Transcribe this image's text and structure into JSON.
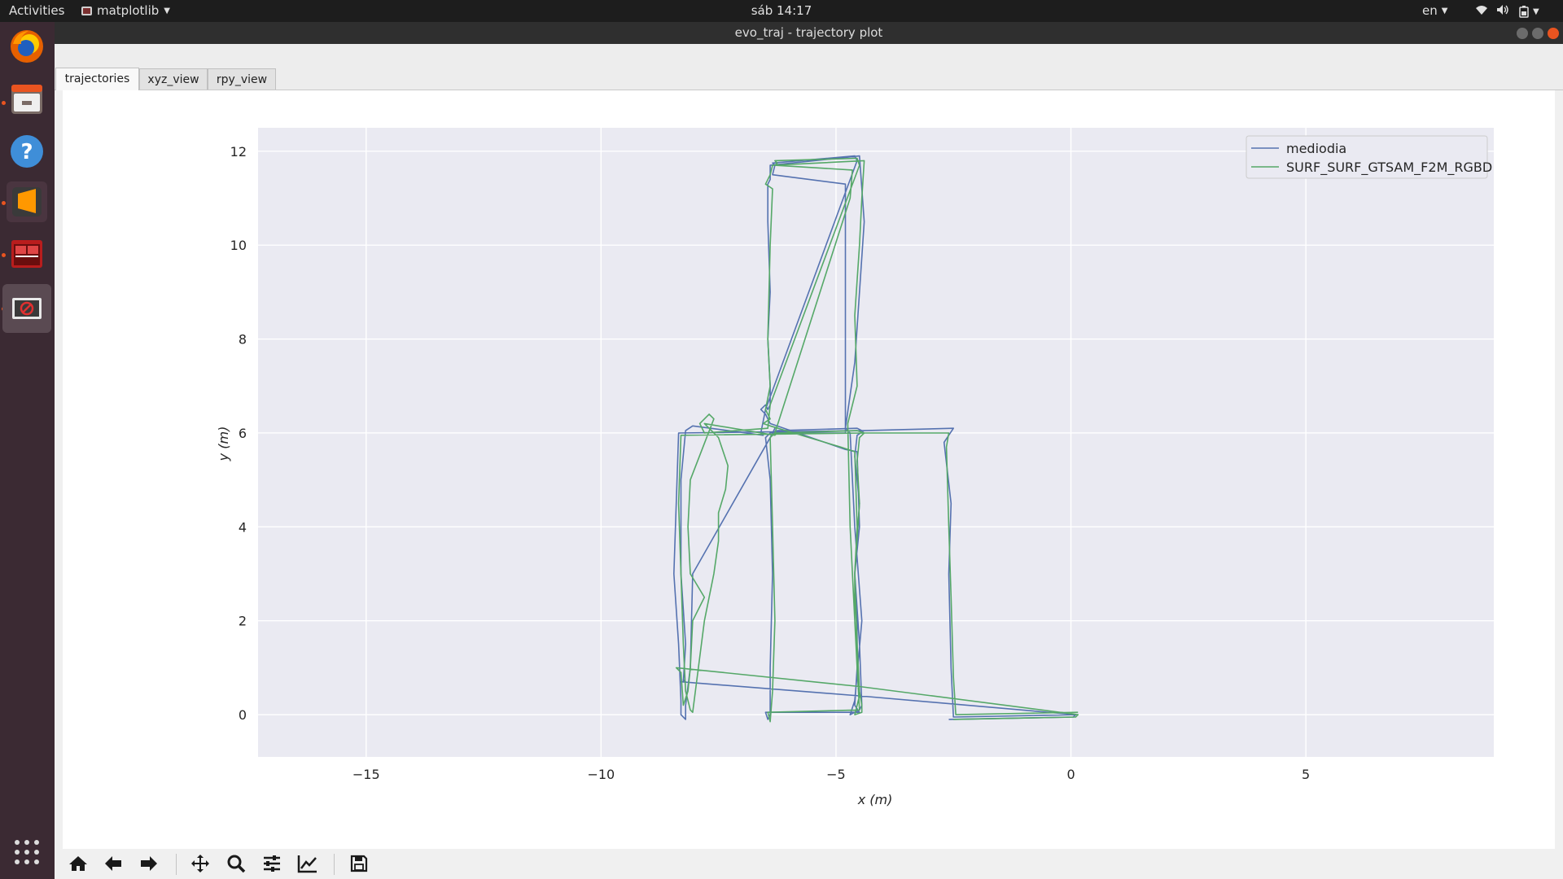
{
  "topbar": {
    "activities": "Activities",
    "app_menu": "matplotlib",
    "clock": "sáb 14:17",
    "language": "en"
  },
  "window": {
    "title": "evo_traj - trajectory plot"
  },
  "tabs": [
    {
      "label": "trajectories",
      "active": true
    },
    {
      "label": "xyz_view",
      "active": false
    },
    {
      "label": "rpy_view",
      "active": false
    }
  ],
  "dock": {
    "items": [
      {
        "name": "firefox-icon",
        "running": true
      },
      {
        "name": "files-icon",
        "running": true
      },
      {
        "name": "help-icon",
        "running": false
      },
      {
        "name": "sublime-text-icon",
        "running": true
      },
      {
        "name": "terminal-icon",
        "running": true
      },
      {
        "name": "matplotlib-window-icon",
        "running": true
      }
    ]
  },
  "toolbar": {
    "tools": [
      "home-icon",
      "back-arrow-icon",
      "forward-arrow-icon",
      "pan-icon",
      "zoom-icon",
      "configure-subplots-icon",
      "edit-axis-icon",
      "save-icon"
    ]
  },
  "colors": {
    "mediodia": "#5572b0",
    "surf": "#55a868",
    "axes_bg": "#eaeaf2",
    "grid": "#ffffff"
  },
  "chart_data": {
    "type": "line",
    "xlabel": "x (m)",
    "ylabel": "y (m)",
    "xlim": [
      -17.3,
      9.0
    ],
    "ylim": [
      -0.9,
      12.5
    ],
    "xticks": [
      -15,
      -10,
      -5,
      0,
      5
    ],
    "yticks": [
      0,
      2,
      4,
      6,
      8,
      10,
      12
    ],
    "xtick_labels": [
      "−15",
      "−10",
      "−5",
      "0",
      "5"
    ],
    "ytick_labels": [
      "0",
      "2",
      "4",
      "6",
      "8",
      "10",
      "12"
    ],
    "grid": true,
    "legend_position": "top-right",
    "series": [
      {
        "name": "mediodia",
        "x": [
          0.1,
          -2.5,
          -2.55,
          -2.6,
          -2.55,
          -2.7,
          -2.5,
          -4.4,
          -4.55,
          -4.6,
          -4.5,
          -4.6,
          -4.5,
          -4.45,
          -4.5,
          -4.6,
          -4.7,
          -4.6,
          -4.45,
          -4.6,
          -4.7,
          -4.8,
          -4.6,
          -4.5,
          -4.4,
          -4.5,
          -6.4,
          -6.4,
          -6.45,
          -6.45,
          -6.4,
          -6.45,
          -6.4,
          -6.4,
          -6.45,
          -6.5,
          -6.6,
          -6.5,
          -6.45,
          -6.4,
          -4.8,
          -4.55,
          -4.5,
          -4.6,
          -4.55,
          -4.55,
          -4.6,
          -4.5,
          -6.5,
          -6.45,
          -6.4,
          -6.4,
          -6.35,
          -6.4,
          -6.5,
          -6.4,
          -6.25,
          -4.55,
          -4.45,
          -4.35,
          -8.35,
          -8.4,
          -8.45,
          -8.35,
          -8.3,
          -8.3,
          -8.2,
          -8.2,
          -8.1,
          -8.05,
          -6.4,
          -6.3,
          -6.35,
          -4.8,
          -4.8,
          -6.35,
          -6.3,
          -6.35,
          -4.6,
          -4.55,
          -6.5,
          -6.6,
          -6.55,
          -8.05,
          -8.2,
          -8.3,
          -8.3,
          -8.2,
          -8.25,
          -8.25,
          -8.25,
          -8.2,
          -8.3,
          -4.5,
          0.1,
          0.05,
          -2.6
        ],
        "y": [
          0.0,
          -0.05,
          1.0,
          3.0,
          4.5,
          5.8,
          6.1,
          6.05,
          5.95,
          5.5,
          4.5,
          3.0,
          1.5,
          0.2,
          0.1,
          0.05,
          0.0,
          0.3,
          2.0,
          4.0,
          6.0,
          6.1,
          7.5,
          9.0,
          10.5,
          11.9,
          11.7,
          11.4,
          11.3,
          10.5,
          9.0,
          8.0,
          7.0,
          6.6,
          6.5,
          6.6,
          6.5,
          6.4,
          6.3,
          6.2,
          5.65,
          5.6,
          4.0,
          3.0,
          2.0,
          1.0,
          0.2,
          0.05,
          0.05,
          -0.1,
          0.0,
          1.0,
          3.0,
          5.0,
          5.9,
          6.0,
          6.05,
          6.1,
          6.05,
          6.05,
          6.0,
          4.5,
          3.0,
          1.5,
          0.3,
          0.0,
          -0.1,
          0.2,
          1.0,
          3.0,
          5.9,
          6.1,
          6.0,
          6.0,
          11.3,
          11.5,
          11.7,
          11.75,
          11.9,
          11.8,
          6.5,
          6.0,
          5.95,
          6.15,
          6.05,
          5.0,
          3.0,
          1.5,
          0.7,
          0.7,
          0.75,
          0.7,
          0.7,
          0.4,
          0.0,
          -0.05,
          -0.1
        ]
      },
      {
        "name": "SURF_SURF_GTSAM_F2M_RGBD",
        "x": [
          0.15,
          -2.45,
          -2.5,
          -2.55,
          -2.6,
          -2.65,
          -2.6,
          -4.4,
          -4.5,
          -4.55,
          -4.5,
          -4.6,
          -4.55,
          -4.5,
          -4.45,
          -4.45,
          -4.6,
          -4.5,
          -4.6,
          -4.7,
          -4.75,
          -4.55,
          -4.6,
          -4.5,
          -4.45,
          -4.4,
          -6.35,
          -6.4,
          -6.5,
          -6.35,
          -6.4,
          -6.45,
          -6.4,
          -6.5,
          -6.45,
          -6.4,
          -6.55,
          -6.4,
          -4.9,
          -4.6,
          -4.55,
          -4.6,
          -4.6,
          -4.55,
          -4.5,
          -6.45,
          -6.4,
          -6.35,
          -6.3,
          -6.35,
          -6.4,
          -6.3,
          -6.2,
          -4.55,
          -4.4,
          -8.3,
          -8.35,
          -8.3,
          -8.25,
          -8.2,
          -8.1,
          -8.05,
          -7.8,
          -7.6,
          -7.5,
          -7.5,
          -7.35,
          -7.3,
          -7.5,
          -7.6,
          -7.8,
          -6.3,
          -6.25,
          -6.3,
          -4.7,
          -4.65,
          -6.3,
          -6.25,
          -6.3,
          -4.55,
          -4.5,
          -6.4,
          -6.45,
          -7.8,
          -7.9,
          -7.7,
          -7.6,
          -8.1,
          -8.15,
          -8.1,
          -7.8,
          -8.05,
          -8.1,
          -8.15,
          -8.25,
          -8.3,
          -8.4,
          -4.5,
          0.15,
          0.1,
          -2.5
        ],
        "y": [
          0.05,
          0.0,
          0.8,
          2.5,
          4.0,
          5.7,
          6.0,
          6.0,
          5.9,
          5.4,
          4.5,
          3.0,
          1.5,
          0.5,
          0.2,
          0.05,
          0.0,
          0.4,
          2.0,
          4.0,
          6.2,
          7.0,
          8.5,
          10.0,
          11.0,
          11.8,
          11.7,
          11.5,
          11.3,
          11.2,
          10.0,
          8.0,
          7.0,
          6.5,
          6.4,
          6.3,
          6.2,
          6.15,
          5.7,
          5.6,
          4.0,
          3.0,
          2.0,
          1.0,
          0.1,
          0.05,
          -0.15,
          0.5,
          2.0,
          4.0,
          5.9,
          6.0,
          6.0,
          6.05,
          6.0,
          5.95,
          4.5,
          3.0,
          1.5,
          0.5,
          0.1,
          0.05,
          2.0,
          3.0,
          3.7,
          4.3,
          4.8,
          5.3,
          5.9,
          6.0,
          6.2,
          5.95,
          6.0,
          6.0,
          11.0,
          11.6,
          11.7,
          11.75,
          11.8,
          11.85,
          11.7,
          6.6,
          6.1,
          6.0,
          6.2,
          6.4,
          6.3,
          5.0,
          4.0,
          3.0,
          2.5,
          2.0,
          1.0,
          0.5,
          0.2,
          0.9,
          1.0,
          0.6,
          0.0,
          -0.05,
          -0.1
        ]
      }
    ]
  }
}
